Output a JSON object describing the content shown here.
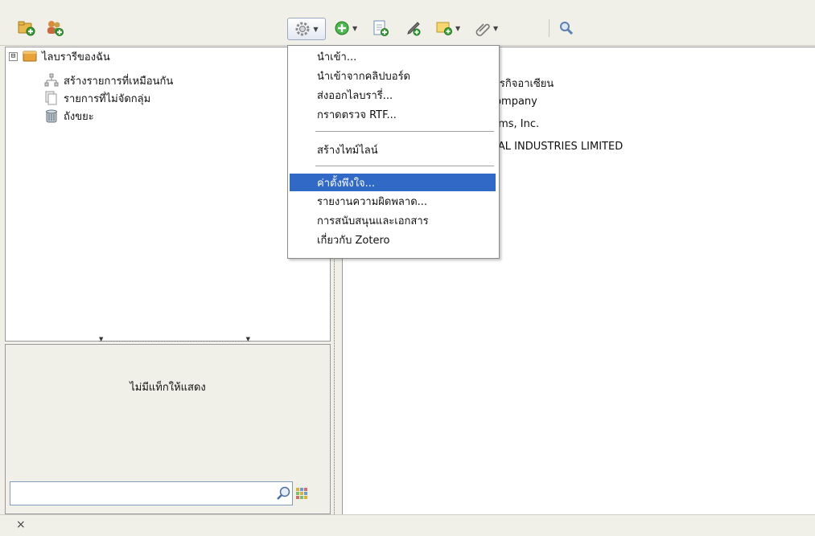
{
  "toolbar": {
    "new_collection": "new-collection-icon",
    "new_group": "new-group-icon",
    "actions": "gear-icon",
    "new_item": "new-item-icon",
    "add_by_identifier": "add-by-identifier-icon",
    "new_note": "new-note-icon",
    "add_attachment": "attachment-icon",
    "advanced_search": "search-icon"
  },
  "collections": {
    "my_library": "ไลบรารีของฉัน",
    "expander": "⊟",
    "items": [
      {
        "label": "สร้างรายการที่เหมือนกัน",
        "icon": "duplicate-items-icon"
      },
      {
        "label": "รายการที่ไม่จัดกลุ่ม",
        "icon": "unfiled-items-icon"
      },
      {
        "label": "ถังขยะ",
        "icon": "trash-icon"
      }
    ]
  },
  "tag_selector": {
    "empty_text": "ไม่มีแท็กให้แสดง",
    "search_value": ""
  },
  "items_pane": {
    "rows": [
      "รธุรกิจอาเซียน",
      "Company",
      "tems, Inc.",
      "ICAL INDUSTRIES LIMITED"
    ]
  },
  "actions_menu": {
    "items": [
      "นำเข้า...",
      "นำเข้าจากคลิปบอร์ด",
      "ส่งออกไลบรารี่...",
      "กราดตรวจ RTF...",
      "สร้างไทม์ไลน์",
      "ค่าตั้งพึงใจ...",
      "รายงานความผิดพลาด...",
      "การสนับสนุนและเอกสาร",
      "เกี่ยวกับ Zotero"
    ],
    "highlighted_index": 5
  },
  "status": {
    "close": "×"
  },
  "colors": {
    "highlight": "#3169c6",
    "background": "#f0efe8"
  }
}
